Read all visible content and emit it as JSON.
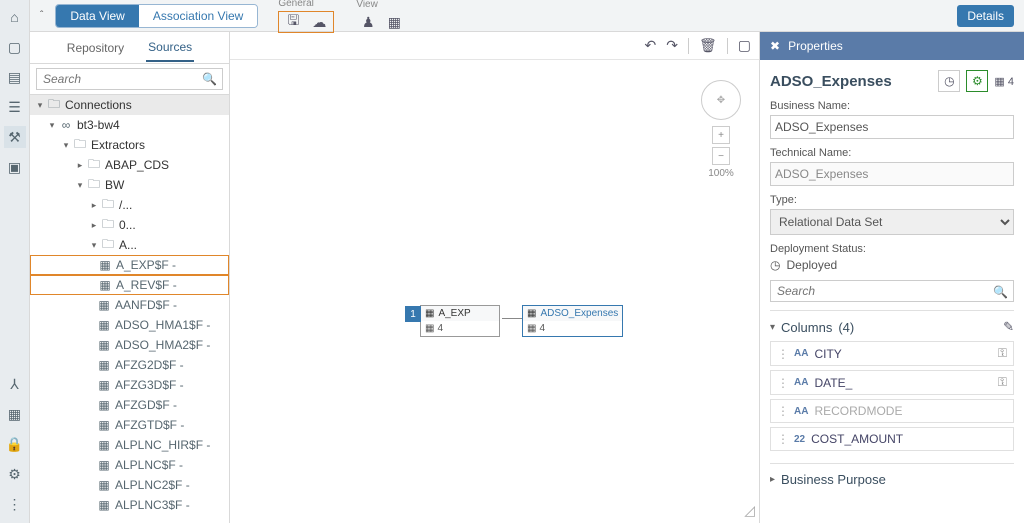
{
  "topbar": {
    "pills": {
      "data_view": "Data View",
      "assoc_view": "Association View"
    },
    "sections": {
      "general": "General",
      "view": "View"
    },
    "details": "Details"
  },
  "sidebar": {
    "tabs": {
      "repository": "Repository",
      "sources": "Sources"
    },
    "search_placeholder": "Search",
    "tree": {
      "connections": "Connections",
      "bt3": "bt3-bw4",
      "extractors": "Extractors",
      "abap_cds": "ABAP_CDS",
      "bw": "BW",
      "slash_a": "/...",
      "zero": "0...",
      "a_folder": "A...",
      "a_exp": "A_EXP$F - ",
      "a_rev": "A_REV$F - ",
      "aanfd": "AANFD$F - ",
      "adso_hma1": "ADSO_HMA1$F - ",
      "adso_hma2": "ADSO_HMA2$F - ",
      "afzg2d": "AFZG2D$F - ",
      "afzg3d": "AFZG3D$F - ",
      "afzgd": "AFZGD$F - ",
      "afzgtd": "AFZGTD$F - ",
      "alplnc_hir": "ALPLNC_HIR$F - ",
      "alplnc": "ALPLNC$F - ",
      "alplnc2": "ALPLNC2$F - ",
      "alplnc3": "ALPLNC3$F - "
    }
  },
  "canvas": {
    "zoom": "100%",
    "node1": {
      "title": "A_EXP",
      "count": "4",
      "badge": "1"
    },
    "node2": {
      "title": "ADSO_Expenses",
      "count": "4"
    }
  },
  "props": {
    "header": "Properties",
    "title": "ADSO_Expenses",
    "count": "4",
    "business_name_label": "Business Name:",
    "business_name_value": "ADSO_Expenses",
    "tech_name_label": "Technical Name:",
    "tech_name_value": "ADSO_Expenses",
    "type_label": "Type:",
    "type_value": "Relational Data Set",
    "deploy_label": "Deployment Status:",
    "deploy_value": "Deployed",
    "search_placeholder": "Search",
    "columns_label": "Columns",
    "columns_count": "(4)",
    "cols": {
      "city": "CITY",
      "date": "DATE_",
      "recordmode": "RECORDMODE",
      "cost": "COST_AMOUNT"
    },
    "bp_label": "Business Purpose"
  }
}
